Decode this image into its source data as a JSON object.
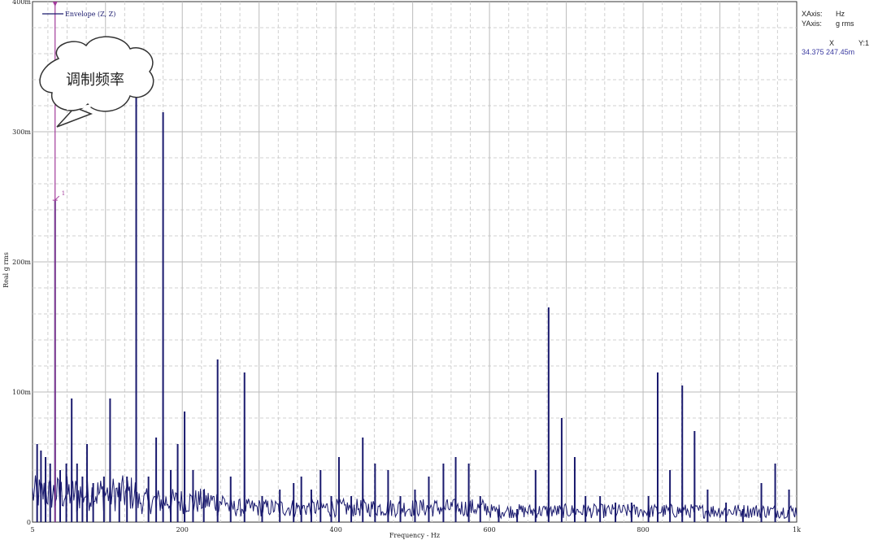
{
  "chart_data": {
    "type": "line",
    "xlabel": "Frequency - Hz",
    "ylabel": "Real g rms",
    "xlim": [
      5,
      1000
    ],
    "ylim": [
      0,
      0.4
    ],
    "x_ticks": [
      {
        "value": 5,
        "label": "5"
      },
      {
        "value": 200,
        "label": "200"
      },
      {
        "value": 400,
        "label": "400"
      },
      {
        "value": 600,
        "label": "600"
      },
      {
        "value": 800,
        "label": "800"
      },
      {
        "value": 1000,
        "label": "1k"
      }
    ],
    "y_ticks": [
      {
        "value": 0,
        "label": "0"
      },
      {
        "value": 0.1,
        "label": "100m"
      },
      {
        "value": 0.2,
        "label": "200m"
      },
      {
        "value": 0.3,
        "label": "300m"
      },
      {
        "value": 0.4,
        "label": "400m"
      }
    ],
    "grid": true,
    "series": [
      {
        "name": "Envelope (Z, Z)",
        "color": "#1a1a6e",
        "peaks": [
          [
            11,
            0.06
          ],
          [
            16,
            0.055
          ],
          [
            22,
            0.05
          ],
          [
            28,
            0.045
          ],
          [
            34.375,
            0.247
          ],
          [
            41,
            0.04
          ],
          [
            49,
            0.045
          ],
          [
            56,
            0.095
          ],
          [
            63,
            0.045
          ],
          [
            70,
            0.035
          ],
          [
            76,
            0.06
          ],
          [
            84,
            0.03
          ],
          [
            98,
            0.035
          ],
          [
            106,
            0.095
          ],
          [
            118,
            0.03
          ],
          [
            128,
            0.035
          ],
          [
            140,
            0.35
          ],
          [
            156,
            0.035
          ],
          [
            166,
            0.065
          ],
          [
            175,
            0.315
          ],
          [
            185,
            0.04
          ],
          [
            194,
            0.06
          ],
          [
            203,
            0.085
          ],
          [
            214,
            0.04
          ],
          [
            228,
            0.025
          ],
          [
            246,
            0.125
          ],
          [
            263,
            0.035
          ],
          [
            281,
            0.115
          ],
          [
            304,
            0.02
          ],
          [
            327,
            0.025
          ],
          [
            345,
            0.03
          ],
          [
            355,
            0.035
          ],
          [
            368,
            0.025
          ],
          [
            380,
            0.04
          ],
          [
            394,
            0.02
          ],
          [
            404,
            0.05
          ],
          [
            420,
            0.02
          ],
          [
            435,
            0.065
          ],
          [
            451,
            0.045
          ],
          [
            468,
            0.04
          ],
          [
            484,
            0.02
          ],
          [
            503,
            0.025
          ],
          [
            521,
            0.035
          ],
          [
            540,
            0.045
          ],
          [
            556,
            0.05
          ],
          [
            573,
            0.045
          ],
          [
            588,
            0.02
          ],
          [
            612,
            0.01
          ],
          [
            636,
            0.01
          ],
          [
            660,
            0.04
          ],
          [
            677,
            0.165
          ],
          [
            694,
            0.08
          ],
          [
            711,
            0.05
          ],
          [
            725,
            0.02
          ],
          [
            744,
            0.02
          ],
          [
            764,
            0.015
          ],
          [
            785,
            0.015
          ],
          [
            807,
            0.02
          ],
          [
            819,
            0.115
          ],
          [
            835,
            0.04
          ],
          [
            851,
            0.105
          ],
          [
            867,
            0.07
          ],
          [
            884,
            0.025
          ],
          [
            908,
            0.015
          ],
          [
            930,
            0.01
          ],
          [
            954,
            0.03
          ],
          [
            972,
            0.045
          ],
          [
            990,
            0.025
          ]
        ]
      }
    ],
    "legend": {
      "label": "Envelope (Z, Z)",
      "placement": "top-left"
    },
    "cursor": {
      "x": 34.375,
      "y": 0.24745,
      "label": "1"
    }
  },
  "info_panel": {
    "xaxis_key": "XAxis:",
    "xaxis_val": "Hz",
    "yaxis_key": "YAxis:",
    "yaxis_val": "g rms",
    "col_x": "X",
    "col_y": "Y:1",
    "readout_x": "34.375",
    "readout_y": "247.45m"
  },
  "annotation": {
    "text": "调制频率"
  }
}
